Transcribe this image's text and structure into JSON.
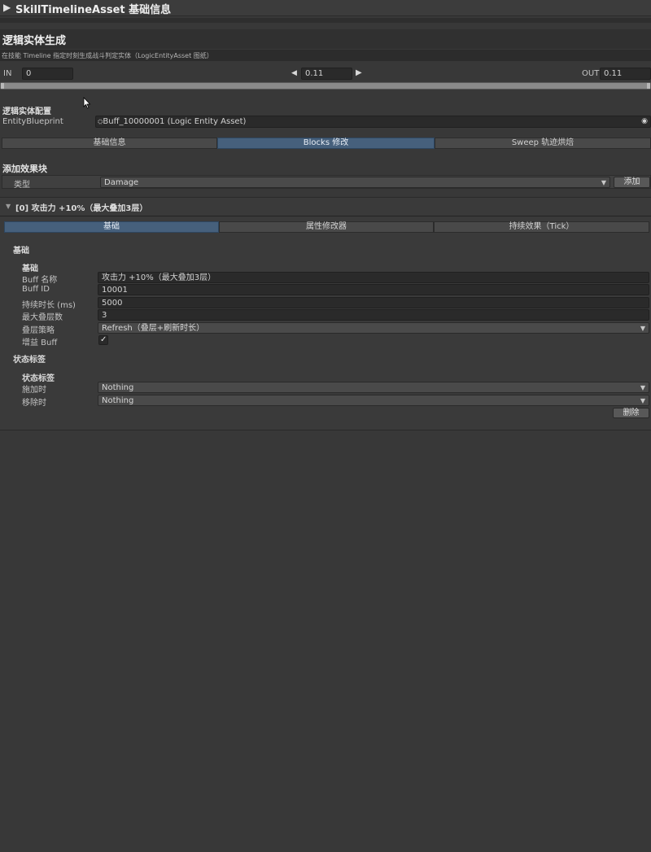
{
  "header": {
    "title": "SkillTimelineAsset 基础信息"
  },
  "section": {
    "title": "逻辑实体生成",
    "subtitle": "在技能 Timeline 指定时刻生成战斗判定实体（LogicEntityAsset 图纸）"
  },
  "timing": {
    "in_label": "IN",
    "in_value": "0",
    "mid_value": "0.11",
    "out_label": "OUT",
    "out_value": "0.11"
  },
  "config": {
    "title": "逻辑实体配置",
    "blueprint_label": "EntityBlueprint",
    "blueprint_value": "Buff_10000001 (Logic Entity Asset)"
  },
  "main_tabs": [
    {
      "label": "基础信息"
    },
    {
      "label": "Blocks 修改"
    },
    {
      "label": "Sweep 轨迹烘焙"
    }
  ],
  "add_block": {
    "title": "添加效果块",
    "type_label": "类型",
    "type_value": "Damage",
    "add_button": "添加"
  },
  "block": {
    "header": "[0] 攻击力 +10%（最大叠加3层）",
    "tabs": [
      {
        "label": "基础"
      },
      {
        "label": "属性修改器"
      },
      {
        "label": "持续效果（Tick）"
      }
    ],
    "group_title": "基础",
    "sub_title": "基础",
    "fields": [
      {
        "label": "Buff 名称",
        "value": "攻击力 +10%（最大叠加3层）"
      },
      {
        "label": "Buff ID",
        "value": "10001"
      },
      {
        "label": "持续时长 (ms)",
        "value": "5000"
      },
      {
        "label": "最大叠层数",
        "value": "3"
      },
      {
        "label": "叠层策略",
        "value": "Refresh（叠层+刷新时长）"
      },
      {
        "label": "增益 Buff",
        "value": "✓"
      }
    ],
    "status_group_title": "状态标签",
    "status_sub_title": "状态标签",
    "status_fields": [
      {
        "label": "施加时",
        "value": "Nothing"
      },
      {
        "label": "移除时",
        "value": "Nothing"
      }
    ],
    "delete_button": "删除"
  },
  "colors": {
    "background": "#383838",
    "active_tab": "#46607c",
    "field": "#2a2a2a"
  },
  "icons": [
    "triangle-right-icon",
    "arrow-left-icon",
    "arrow-right-icon",
    "object-picker-icon",
    "foldout-down-icon",
    "dropdown-arrow-icon",
    "checkmark-icon",
    "asset-icon"
  ]
}
